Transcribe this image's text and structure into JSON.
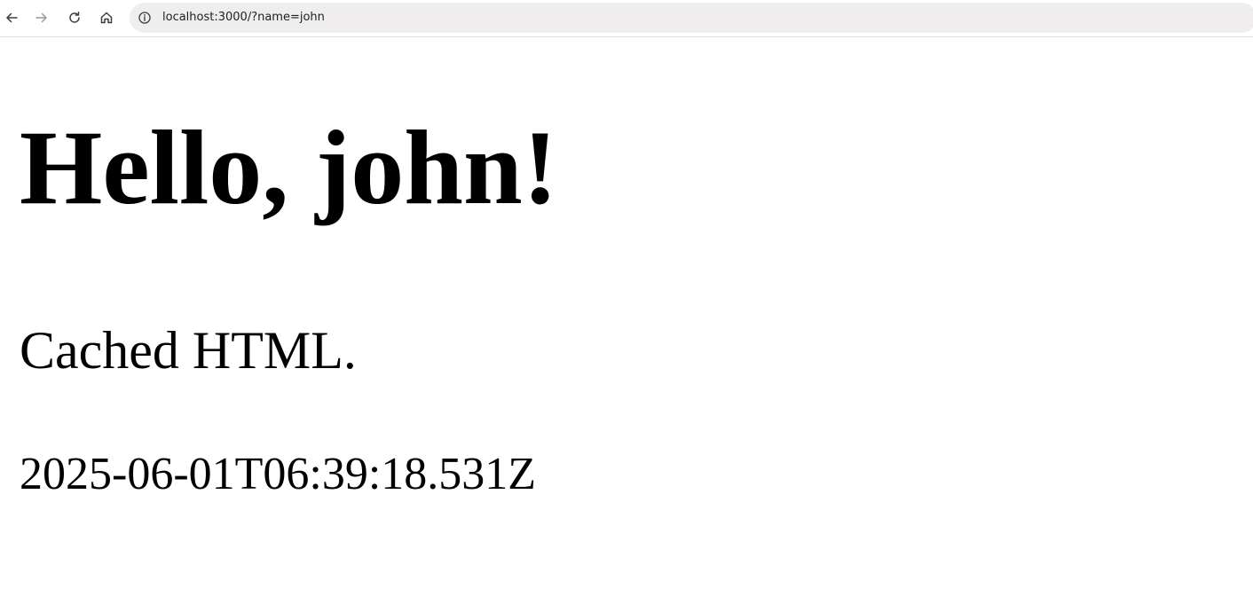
{
  "browser": {
    "url": "localhost:3000/?name=john",
    "icons": {
      "back": "arrow-left-icon",
      "forward": "arrow-right-icon",
      "reload": "reload-icon",
      "home": "home-icon",
      "site_info": "info-icon"
    },
    "colors": {
      "urlbar_background": "#efeded",
      "icon_active": "#3c3c3c",
      "icon_disabled": "#9a9a9a"
    }
  },
  "page": {
    "heading": "Hello, john!",
    "subtitle": "Cached HTML.",
    "timestamp": "2025-06-01T06:39:18.531Z"
  }
}
